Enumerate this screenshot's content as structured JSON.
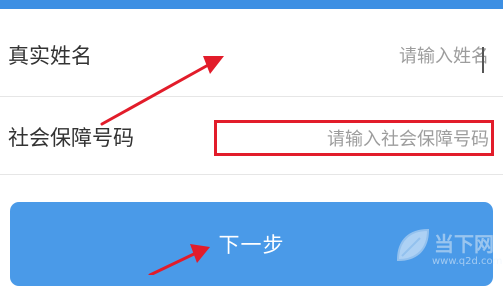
{
  "form": {
    "name_label": "真实姓名",
    "name_placeholder": "请输入姓名",
    "ssn_label": "社会保障号码",
    "ssn_placeholder": "请输入社会保障号码",
    "next_label": "下一步"
  },
  "watermark": {
    "title": "当下网",
    "url": "www.q2d.com"
  },
  "colors": {
    "primary_blue": "#4a9ae8",
    "highlight_red": "#e21c2a",
    "annotation_arrow": "#e21c2a"
  },
  "icons": {
    "annotation_arrow": "arrow-icon",
    "watermark_logo": "leaf-logo-icon"
  }
}
